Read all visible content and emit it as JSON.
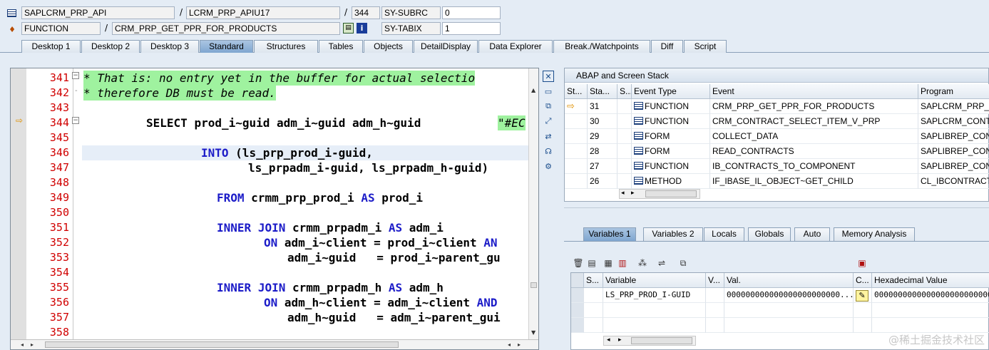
{
  "header": {
    "row1": {
      "program": "SAPLCRM_PRP_API",
      "include": "LCRM_PRP_APIU17",
      "line": "344",
      "sysfield_label": "SY-SUBRC",
      "sysfield_value": "0"
    },
    "row2": {
      "event_type": "FUNCTION",
      "event": "CRM_PRP_GET_PPR_FOR_PRODUCTS",
      "sysfield_label": "SY-TABIX",
      "sysfield_value": "1"
    },
    "separator": "/"
  },
  "tabs": [
    "Desktop 1",
    "Desktop 2",
    "Desktop 3",
    "Standard",
    "Structures",
    "Tables",
    "Objects",
    "DetailDisplay",
    "Data Explorer",
    "Break./Watchpoints",
    "Diff",
    "Script"
  ],
  "active_tab": "Standard",
  "code": [
    {
      "n": "341",
      "text": "* That is: no entry yet in the buffer for actual selectio"
    },
    {
      "n": "342",
      "text": "* therefore DB must be read."
    },
    {
      "n": "343"
    },
    {
      "n": "344"
    },
    {
      "n": "345"
    },
    {
      "n": "346"
    },
    {
      "n": "347"
    },
    {
      "n": "348"
    },
    {
      "n": "349"
    },
    {
      "n": "350"
    },
    {
      "n": "351"
    },
    {
      "n": "352"
    },
    {
      "n": "353"
    },
    {
      "n": "354"
    },
    {
      "n": "355"
    },
    {
      "n": "356"
    },
    {
      "n": "357"
    },
    {
      "n": "358"
    }
  ],
  "code_tokens": {
    "select": "SELECT",
    "select_fields": "prod_i~guid adm_i~guid adm_h~guid",
    "pragma": "\"#EC",
    "into": "INTO",
    "into_1": "(ls_prp_prod_i-guid,",
    "into_2": "ls_prpadm_i-guid, ls_prpadm_h-guid)",
    "from": "FROM",
    "from_rest": "crmm_prp_prod_i",
    "as": "AS",
    "alias_prod": "prod_i",
    "inner": "INNER",
    "join": "JOIN",
    "join1_table": "crmm_prpadm_i",
    "alias_adm_i": "adm_i",
    "on": "ON",
    "cond1a": "adm_i~client = prod_i~client",
    "and": "AN",
    "cond1b": "adm_i~guid   = prod_i~parent_gu",
    "join2_table": "crmm_prpadm_h",
    "alias_adm_h": "adm_h",
    "cond2a": "adm_h~client = adm_i~client",
    "and2": "AND",
    "cond2b": "adm_h~guid   = adm_i~parent_gui"
  },
  "stack": {
    "title": "ABAP and Screen Stack",
    "columns": [
      "St...",
      "Sta...",
      "S...",
      "Event Type",
      "Event",
      "Program"
    ],
    "rows": [
      {
        "level": "31",
        "type": "FUNCTION",
        "event": "CRM_PRP_GET_PPR_FOR_PRODUCTS",
        "program": "SAPLCRM_PRP_API"
      },
      {
        "level": "30",
        "type": "FUNCTION",
        "event": "CRM_CONTRACT_SELECT_ITEM_V_PRP",
        "program": "SAPLCRM_CONTRA"
      },
      {
        "level": "29",
        "type": "FORM",
        "event": "COLLECT_DATA",
        "program": "SAPLIBREP_CONT"
      },
      {
        "level": "28",
        "type": "FORM",
        "event": "READ_CONTRACTS",
        "program": "SAPLIBREP_CONT"
      },
      {
        "level": "27",
        "type": "FUNCTION",
        "event": "IB_CONTRACTS_TO_COMPONENT",
        "program": "SAPLIBREP_CONT"
      },
      {
        "level": "26",
        "type": "METHOD",
        "event": "IF_IBASE_IL_OBJECT~GET_CHILD",
        "program": "CL_IBCONTRACT_"
      }
    ]
  },
  "vars": {
    "tabs": [
      "Variables 1",
      "Variables 2",
      "Locals",
      "Globals",
      "Auto",
      "Memory Analysis"
    ],
    "active_tab": "Variables 1",
    "columns": [
      "S...",
      "Variable",
      "V...",
      "Val.",
      "C...",
      "Hexadecimal Value"
    ],
    "rows": [
      {
        "variable": "LS_PRP_PROD_I-GUID",
        "value": "000000000000000000000000...",
        "hex": "00000000000000000000000000"
      }
    ]
  },
  "watermark": "@稀土掘金技术社区"
}
